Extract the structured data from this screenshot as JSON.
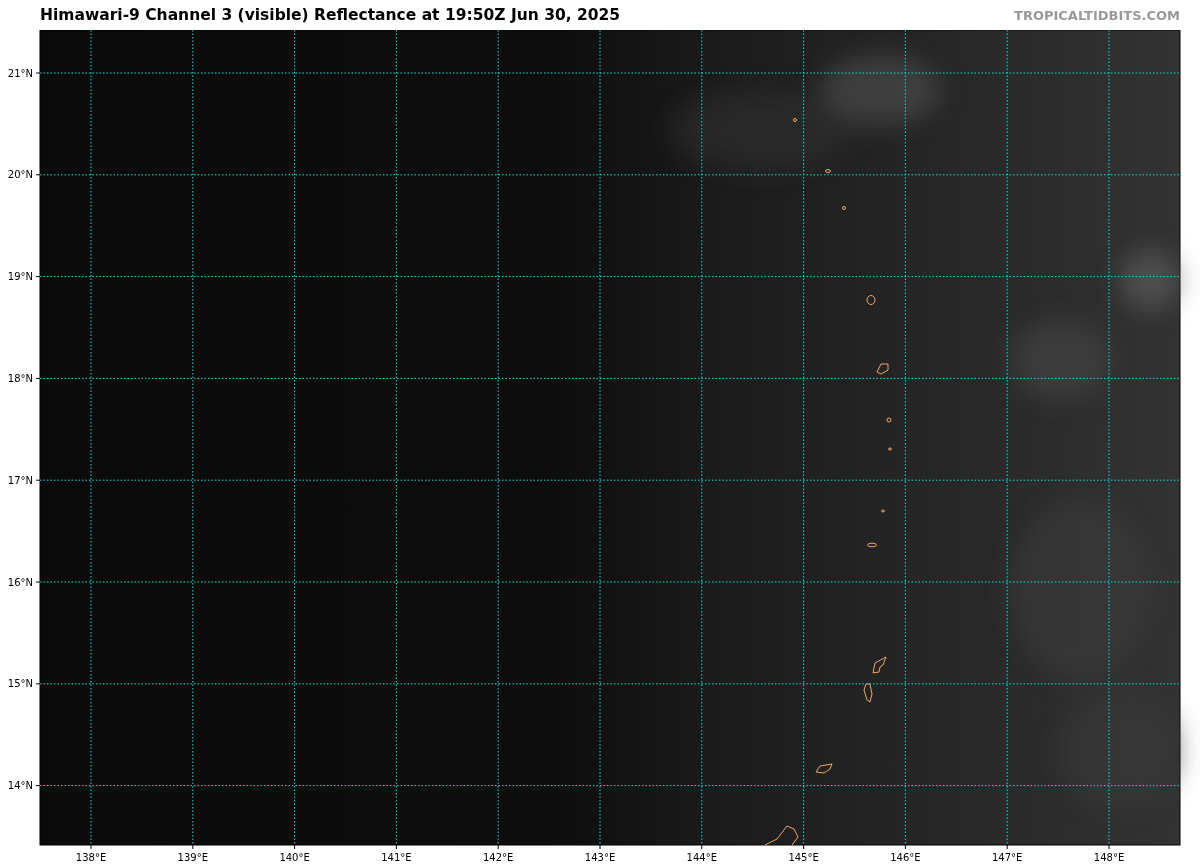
{
  "title": "Himawari-9 Channel 3 (visible) Reflectance at 19:50Z Jun 30, 2025",
  "credit": "TROPICALTIDBITS.COM",
  "map": {
    "lat_labels": [
      "21°N",
      "20°N",
      "19°N",
      "18°N",
      "17°N",
      "16°N",
      "15°N",
      "14°N"
    ],
    "lon_labels": [
      "138°E",
      "139°E",
      "140°E",
      "141°E",
      "142°E",
      "143°E",
      "144°E",
      "145°E",
      "146°E",
      "147°E",
      "148°E"
    ]
  }
}
